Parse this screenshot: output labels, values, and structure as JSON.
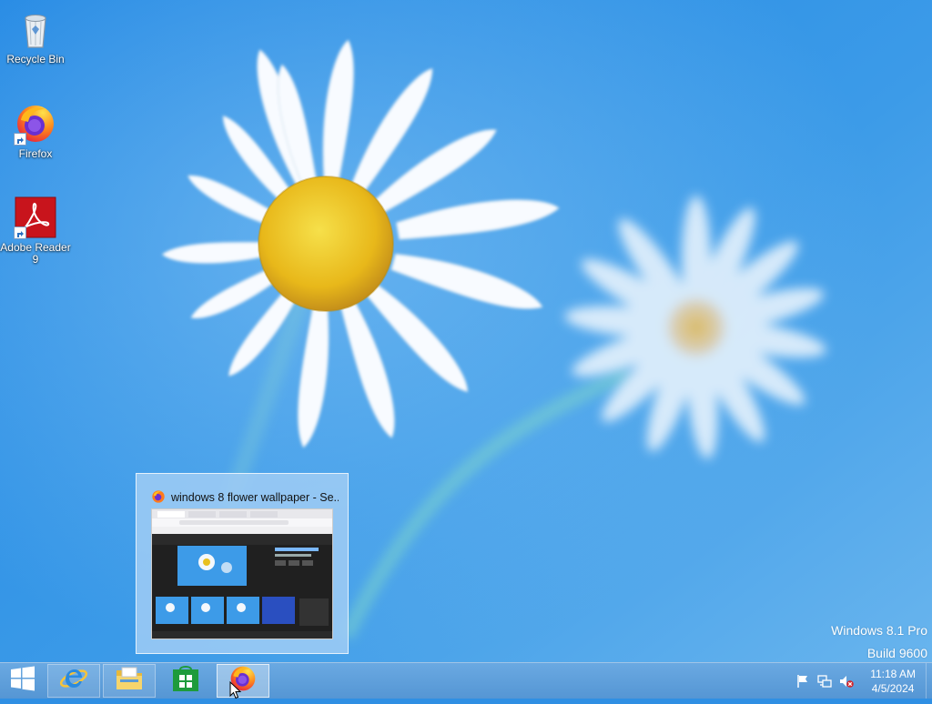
{
  "desktop": {
    "icons": [
      {
        "label": "Recycle Bin",
        "icon": "recycle-bin-icon"
      },
      {
        "label": "Firefox",
        "icon": "firefox-icon"
      },
      {
        "label": "Adobe Reader 9",
        "icon": "adobe-reader-icon"
      }
    ],
    "watermark": {
      "line1": "Windows 8.1 Pro",
      "line2": "Build 9600"
    }
  },
  "preview": {
    "title": "windows 8 flower wallpaper - Se...",
    "icon": "firefox-icon"
  },
  "taskbar": {
    "start_icon": "windows-logo-icon",
    "pinned": [
      {
        "name": "Internet Explorer",
        "icon": "internet-explorer-icon"
      },
      {
        "name": "File Explorer",
        "icon": "file-explorer-icon"
      },
      {
        "name": "Store",
        "icon": "store-icon"
      },
      {
        "name": "Firefox",
        "icon": "firefox-icon",
        "active": true
      }
    ],
    "tray": {
      "icons": [
        "action-center-flag-icon",
        "network-icon",
        "volume-muted-icon"
      ],
      "time": "11:18 AM",
      "date": "4/5/2024"
    }
  },
  "colors": {
    "wallpaper_top": "#2a8ae0",
    "wallpaper_bottom": "#5fb0ec",
    "taskbar": "#5c9ed9",
    "accent": "#ffffff"
  }
}
